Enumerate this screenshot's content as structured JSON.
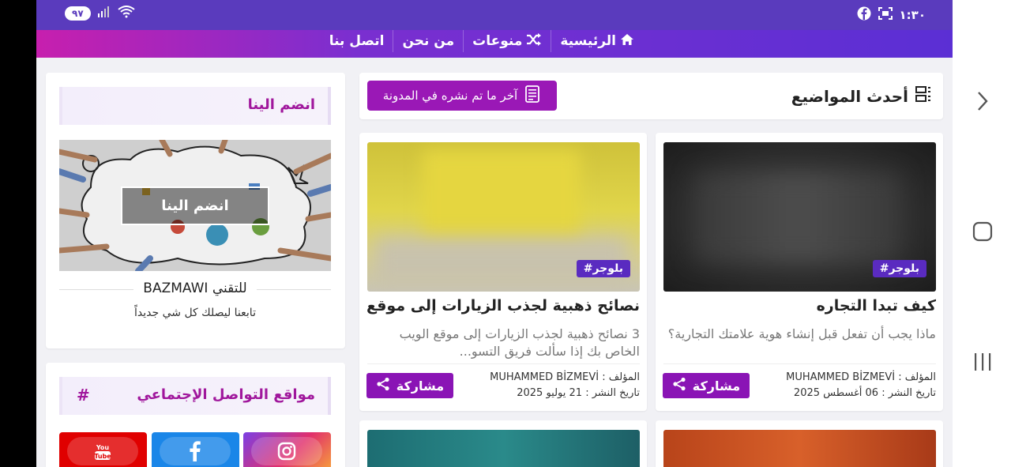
{
  "status_bar": {
    "battery": "٩٧",
    "time": "١:٣٠"
  },
  "nav": {
    "items": [
      {
        "label": "الرئيسية",
        "icon": "home-icon"
      },
      {
        "label": "منوعات",
        "icon": "shuffle-icon"
      },
      {
        "label": "من نحن",
        "icon": ""
      },
      {
        "label": "اتصل بنا",
        "icon": ""
      }
    ]
  },
  "latest": {
    "title": "أحدث المواضيع",
    "subtitle": "آخر ما تم نشره في المدونة"
  },
  "posts": [
    {
      "tag": "#بلوجر",
      "title": "كيف تبدا التجاره",
      "desc": "ماذا يجب أن تفعل قبل إنشاء هوية علامتك التجارية؟",
      "author_line": "المؤلف : MUHAMMED BİZMEVİ",
      "date_line": "تاريخ النشر : 06 أغسطس 2025",
      "share": "مشاركة"
    },
    {
      "tag": "#بلوجر",
      "title": "نصائح ذهبية لجذب الزيارات إلى موقع الـ...",
      "desc": "3 نصائح ذهبية لجذب الزيارات إلى موقع الويب الخاص بك إذا سألت فريق التسو...",
      "author_line": "المؤلف : MUHAMMED BİZMEVİ",
      "date_line": "تاريخ النشر : 21 يوليو 2025",
      "share": "مشاركة"
    }
  ],
  "sidebar": {
    "join": {
      "title": "انضم الينا",
      "image_button": "انضم الينا",
      "subtitle": "BAZMAWI للتقني",
      "caption": "تابعنا ليصلك كل شي جديداً"
    },
    "social": {
      "title": "مواقع التواصل الإجتماعي",
      "hash": "#",
      "networks": [
        {
          "name": "instagram-icon",
          "color": "#e1306c"
        },
        {
          "name": "facebook-icon",
          "color": "#1877f2"
        },
        {
          "name": "youtube-icon",
          "color": "#e00000"
        }
      ]
    }
  },
  "colors": {
    "status_bar": "#5a3bbd",
    "accent_purple": "#9a18b6",
    "tag_bg": "#5a2bc0"
  }
}
